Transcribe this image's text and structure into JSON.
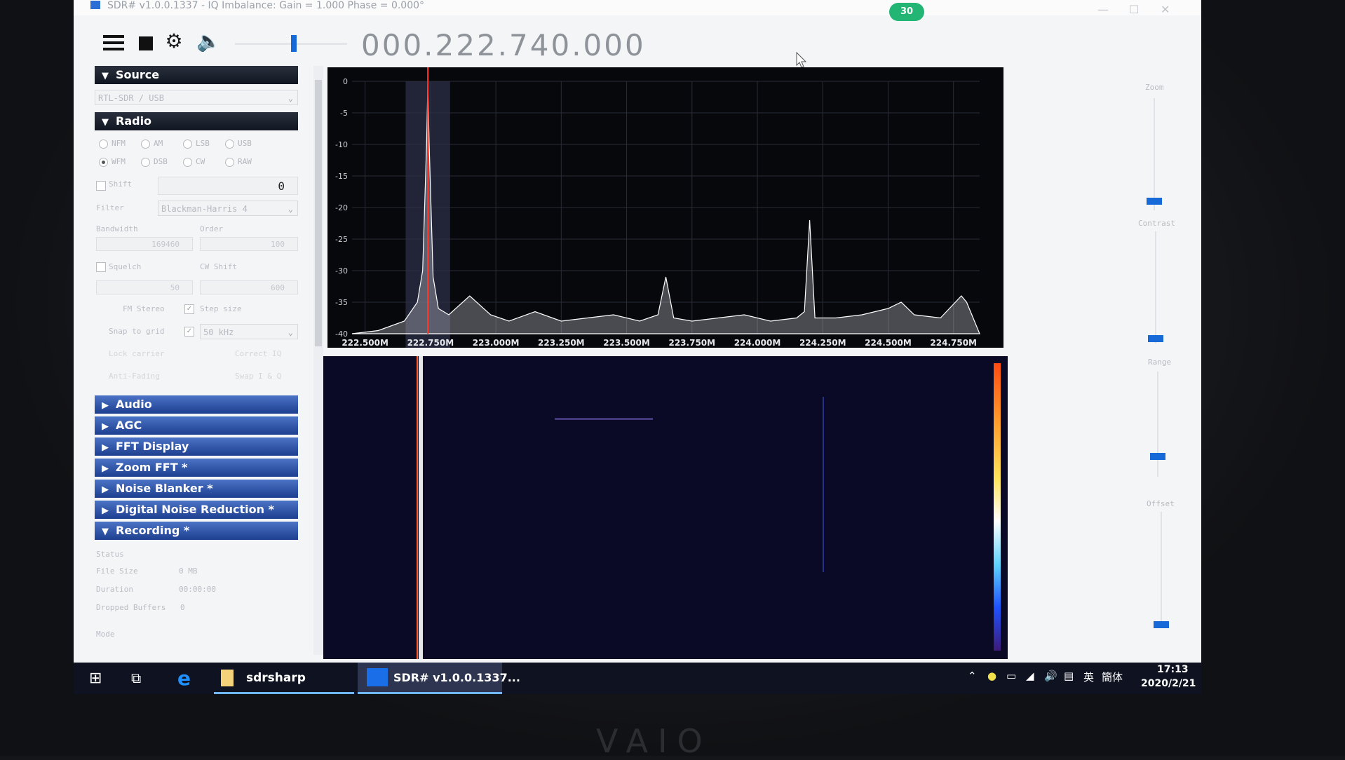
{
  "window": {
    "title": "SDR# v1.0.0.1337 - IQ Imbalance: Gain = 1.000 Phase = 0.000°",
    "badge": "30"
  },
  "toolbar": {
    "frequency": "000.222.740.000"
  },
  "panel": {
    "source": {
      "header": "Source",
      "device": "RTL-SDR / USB"
    },
    "radio": {
      "header": "Radio",
      "modes": [
        "NFM",
        "AM",
        "LSB",
        "USB",
        "WFM",
        "DSB",
        "CW",
        "RAW"
      ],
      "selected_mode": "WFM",
      "shift_label": "Shift",
      "shift_value": "0",
      "filter_label": "Filter",
      "filter_value": "Blackman-Harris 4",
      "bandwidth_label": "Bandwidth",
      "bandwidth_value": "169460",
      "order_label": "Order",
      "order_value": "100",
      "squelch_label": "Squelch",
      "squelch_value": "50",
      "cw_shift_label": "CW Shift",
      "cw_shift_value": "600",
      "fm_stereo_label": "FM Stereo",
      "step_size_label": "Step size",
      "snap_label": "Snap to grid",
      "step_value": "50 kHz",
      "lock_carrier_label": "Lock carrier",
      "correct_iq_label": "Correct IQ",
      "anti_fading_label": "Anti-Fading",
      "swap_iq_label": "Swap I & Q"
    },
    "sections": [
      "Audio",
      "AGC",
      "FFT Display",
      "Zoom FFT *",
      "Noise Blanker *",
      "Digital Noise Reduction *"
    ],
    "recording": {
      "header": "Recording *",
      "status_label": "Status",
      "file_size_label": "File Size",
      "file_size_value": "0 MB",
      "duration_label": "Duration",
      "duration_value": "00:00:00",
      "dropped_label": "Dropped Buffers",
      "dropped_value": "0",
      "mode_label": "Mode"
    }
  },
  "right_sliders": {
    "zoom_label": "Zoom",
    "contrast_label": "Contrast",
    "range_label": "Range",
    "offset_label": "Offset"
  },
  "chart_data": {
    "type": "line",
    "ylim": [
      -40,
      0
    ],
    "yticks": [
      "0",
      "-5",
      "-10",
      "-15",
      "-20",
      "-25",
      "-30",
      "-35",
      "-40"
    ],
    "xticks": [
      "222.500M",
      "222.750M",
      "223.000M",
      "223.250M",
      "223.500M",
      "223.750M",
      "224.000M",
      "224.250M",
      "224.500M",
      "224.750M"
    ],
    "xlim": [
      222.45,
      224.85
    ],
    "tuned": 222.74,
    "series": [
      {
        "x": [
          222.45,
          222.55,
          222.65,
          222.7,
          222.72,
          222.735,
          222.74,
          222.745,
          222.76,
          222.78,
          222.82,
          222.9,
          222.98,
          223.05,
          223.15,
          223.25,
          223.35,
          223.45,
          223.55,
          223.62,
          223.65,
          223.68,
          223.75,
          223.85,
          223.95,
          224.05,
          224.15,
          224.18,
          224.2,
          224.22,
          224.3,
          224.4,
          224.5,
          224.55,
          224.6,
          224.7,
          224.78,
          224.8,
          224.85
        ],
        "y": [
          -40,
          -39.5,
          -38,
          -35,
          -30,
          -10,
          -0.5,
          -10,
          -31,
          -36,
          -37,
          -34,
          -37,
          -38,
          -36.5,
          -38,
          -37.5,
          -37,
          -38,
          -37,
          -31,
          -37.5,
          -38,
          -37.5,
          -37,
          -38,
          -37.5,
          -36.5,
          -22,
          -37.5,
          -37.5,
          -37,
          -36,
          -35,
          -37,
          -37.5,
          -34,
          -35,
          -40
        ]
      }
    ]
  },
  "taskbar": {
    "sdrsharp_label": "sdrsharp",
    "active_label": "SDR# v1.0.0.1337...",
    "time": "17:13",
    "date": "2020/2/21",
    "ime1": "英",
    "ime2": "簡体"
  }
}
